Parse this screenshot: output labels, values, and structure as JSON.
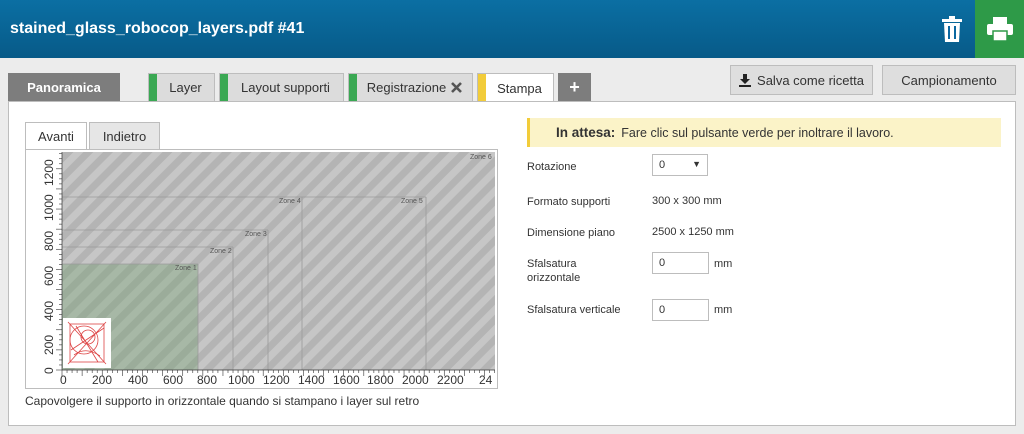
{
  "window": {
    "title": "stained_glass_robocop_layers.pdf #41"
  },
  "header": {
    "delete_icon": "trash-icon",
    "print_icon": "printer-icon",
    "print_color": "#2e9a48"
  },
  "tabs": [
    {
      "label": "Panoramica"
    },
    {
      "label": "Layer",
      "status_color": "#3aa853"
    },
    {
      "label": "Layout supporti",
      "status_color": "#3aa853"
    },
    {
      "label": "Registrazione",
      "status_color": "#3aa853",
      "close_icon": "x-icon"
    },
    {
      "label": "Stampa",
      "status_color": "#f2cc3a",
      "active": true
    },
    {
      "label": "+"
    }
  ],
  "toolbar": {
    "save_recipe": "Salva come ricetta",
    "sampling": "Campionamento"
  },
  "preview": {
    "subtabs": [
      "Avanti",
      "Indietro"
    ],
    "zones": [
      "Zone 1",
      "Zone 2",
      "Zone 3",
      "Zone 4",
      "Zone 5",
      "Zone 6"
    ],
    "x_ticks": [
      "0",
      "200",
      "400",
      "600",
      "800",
      "1000",
      "1200",
      "1400",
      "1600",
      "1800",
      "2000",
      "2200",
      "24"
    ],
    "y_ticks": [
      "0",
      "200",
      "400",
      "600",
      "800",
      "1000",
      "1200"
    ],
    "caption": "Capovolgere il supporto in orizzontale quando si stampano i layer sul retro"
  },
  "notice": {
    "label": "In attesa:",
    "text": "Fare clic sul pulsante verde per inoltrare il lavoro."
  },
  "settings": {
    "rotation_label": "Rotazione",
    "rotation_value": "0",
    "media_size_label": "Formato supporti",
    "media_size_value": "300 x 300 mm",
    "bed_size_label": "Dimensione piano",
    "bed_size_value": "2500 x 1250 mm",
    "h_offset_label_1": "Sfalsatura",
    "h_offset_label_2": "orizzontale",
    "h_offset_value": "0",
    "h_offset_unit": "mm",
    "v_offset_label": "Sfalsatura verticale",
    "v_offset_value": "0",
    "v_offset_unit": "mm"
  }
}
